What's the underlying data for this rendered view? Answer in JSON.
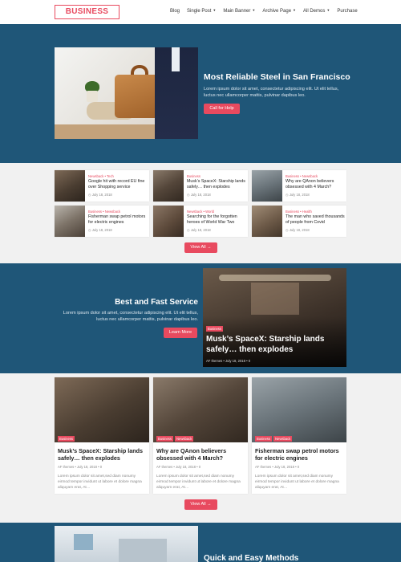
{
  "header": {
    "logo": "BUSINESS",
    "nav": [
      {
        "label": "Blog",
        "dropdown": false
      },
      {
        "label": "Single Post",
        "dropdown": true
      },
      {
        "label": "Main Banner",
        "dropdown": true
      },
      {
        "label": "Archive Page",
        "dropdown": true
      },
      {
        "label": "All Demos",
        "dropdown": true
      },
      {
        "label": "Purchase",
        "dropdown": false
      }
    ]
  },
  "hero": {
    "title": "Most Reliable Steel in San Francisco",
    "text": "Lorem ipsum dolor sit amet, consectetur adipiscing elit. Ut elit tellus, luctus nec ullamcorper mattis, pulvinar dapibus leo.",
    "button": "Call for Help"
  },
  "grid": {
    "items": [
      {
        "category": "Newsback • Tech",
        "title": "Google hit with record EU fine over Shopping service",
        "date": "July 18, 2018"
      },
      {
        "category": "Business",
        "title": "Musk’s SpaceX: Starship lands safely… then explodes",
        "date": "July 18, 2018"
      },
      {
        "category": "Business • Newsback",
        "title": "Why are QAnon believers obsessed with 4 March?",
        "date": "July 18, 2018"
      },
      {
        "category": "Business • Newsback",
        "title": "Fisherman swap petrol motors for electric engines",
        "date": "July 18, 2018"
      },
      {
        "category": "Newsback • World",
        "title": "Searching for the forgotten heroes of World War Two",
        "date": "July 18, 2018"
      },
      {
        "category": "Business • Health",
        "title": "The man who saved thousands of people from Covid",
        "date": "July 18, 2018"
      }
    ],
    "view_all": "View All →"
  },
  "feature": {
    "title": "Best and Fast Service",
    "text": "Lorem ipsum dolor sit amet, consectetur adipiscing elit. Ut elit tellus, luctus nec ullamcorper mattis, pulvinar dapibus leo.",
    "button": "Learn More",
    "card": {
      "badge": "Business",
      "title": "Musk’s SpaceX: Starship lands safely… then explodes",
      "meta": "AF themes  •  July 18, 2018  •  0"
    }
  },
  "cards": {
    "items": [
      {
        "badges": [
          "Business"
        ],
        "title": "Musk’s SpaceX: Starship lands safely… then explodes",
        "meta": "AF themes  •  July 18, 2018  •  0",
        "excerpt": "Lorem ipsum dolor sit amet,sed diam nonumy eirmod tempor invidunt ut labore et dolore magna aliquyam erat, At…"
      },
      {
        "badges": [
          "Business",
          "Newsback"
        ],
        "title": "Why are QAnon believers obsessed with 4 March?",
        "meta": "AF themes  •  July 18, 2018  •  0",
        "excerpt": "Lorem ipsum dolor sit amet,sed diam nonumy eirmod tempor invidunt ut labore et dolore magna aliquyam erat, At…"
      },
      {
        "badges": [
          "Business",
          "Newsback"
        ],
        "title": "Fisherman swap petrol motors for electric engines",
        "meta": "AF themes  •  July 18, 2018  •  0",
        "excerpt": "Lorem ipsum dolor sit amet,sed diam nonumy eirmod tempor invidunt ut labore et dolore magna aliquyam erat, At…"
      }
    ],
    "view_all": "View All →"
  },
  "bottom": {
    "title": "Quick and Easy Methods"
  },
  "colors": {
    "accent": "#e84a5f",
    "dark_blue": "#1f5678",
    "light_bg": "#f1f1f1"
  }
}
